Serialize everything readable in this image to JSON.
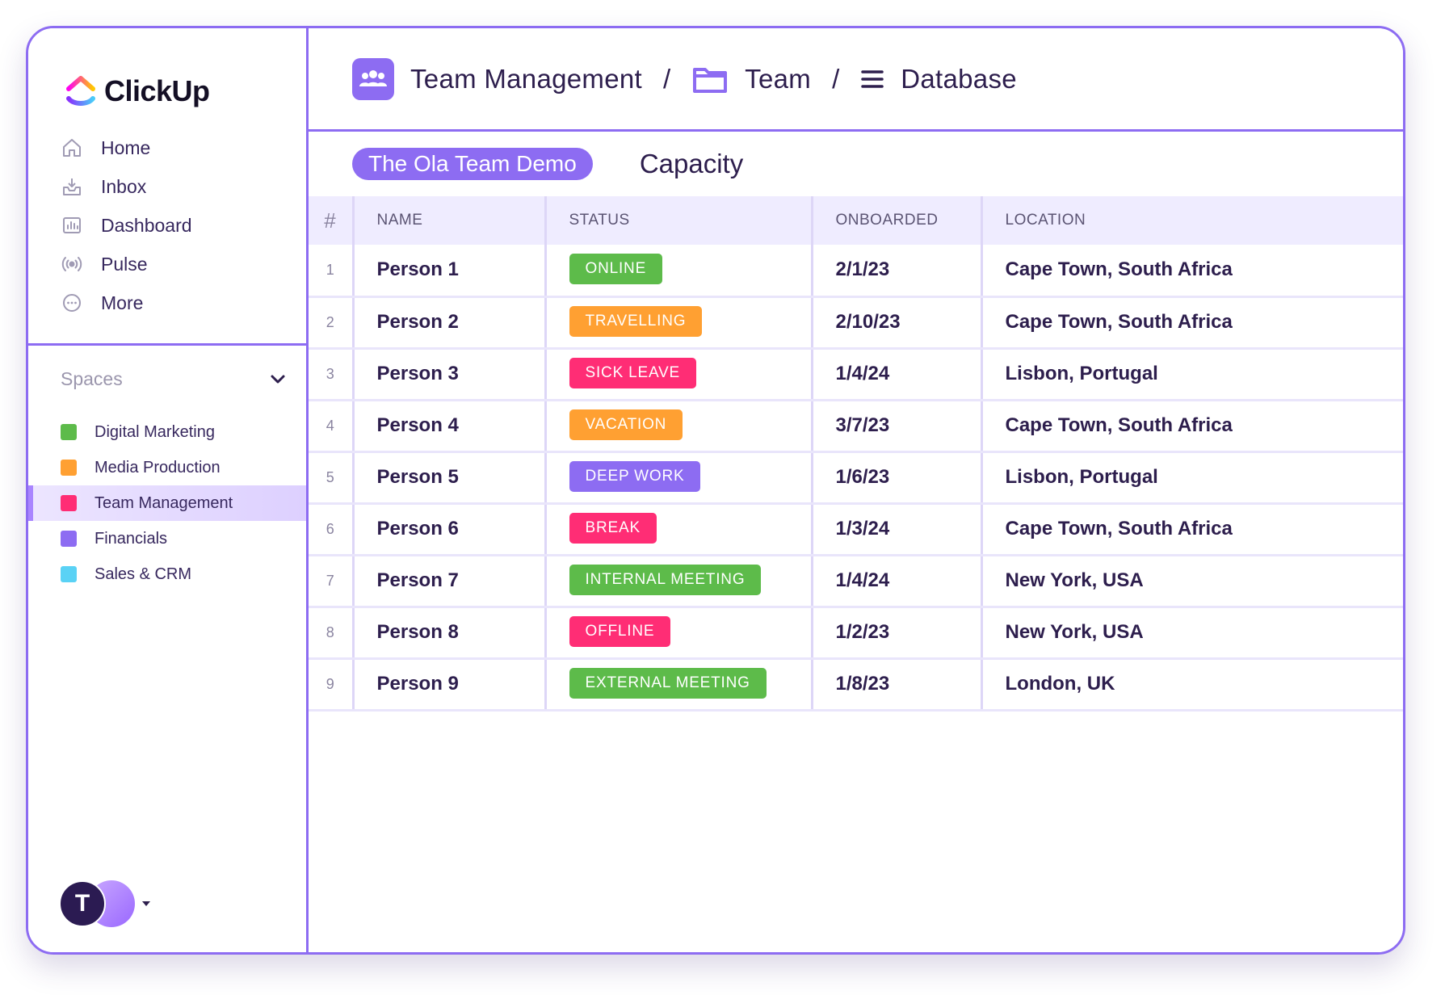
{
  "app": {
    "logo_text": "ClickUp"
  },
  "sidebar": {
    "nav": [
      {
        "label": "Home",
        "icon": "home-icon"
      },
      {
        "label": "Inbox",
        "icon": "inbox-icon"
      },
      {
        "label": "Dashboard",
        "icon": "dashboard-icon"
      },
      {
        "label": "Pulse",
        "icon": "pulse-icon"
      },
      {
        "label": "More",
        "icon": "more-icon"
      }
    ],
    "spaces_label": "Spaces",
    "spaces": [
      {
        "label": "Digital Marketing",
        "color": "#5dbb4a",
        "active": false
      },
      {
        "label": "Media Production",
        "color": "#ffa032",
        "active": false
      },
      {
        "label": "Team Management",
        "color": "#ff2d75",
        "active": true
      },
      {
        "label": "Financials",
        "color": "#8d6cf2",
        "active": false
      },
      {
        "label": "Sales & CRM",
        "color": "#5ad2f5",
        "active": false
      }
    ],
    "avatar_initial": "T"
  },
  "header": {
    "breadcrumb": [
      "Team Management",
      "Team",
      "Database"
    ],
    "separator": "/"
  },
  "view": {
    "workspace_pill": "The Ola Team Demo",
    "title": "Capacity"
  },
  "table": {
    "columns": [
      "#",
      "NAME",
      "STATUS",
      "ONBOARDED",
      "LOCATION"
    ],
    "rows": [
      {
        "idx": "1",
        "name": "Person 1",
        "status": "ONLINE",
        "status_color": "#5dbb4a",
        "onboarded": "2/1/23",
        "location": "Cape Town, South Africa"
      },
      {
        "idx": "2",
        "name": "Person 2",
        "status": "TRAVELLING",
        "status_color": "#ffa032",
        "onboarded": "2/10/23",
        "location": "Cape Town, South Africa"
      },
      {
        "idx": "3",
        "name": "Person 3",
        "status": "SICK LEAVE",
        "status_color": "#ff2d75",
        "onboarded": "1/4/24",
        "location": "Lisbon, Portugal"
      },
      {
        "idx": "4",
        "name": "Person 4",
        "status": "VACATION",
        "status_color": "#ffa032",
        "onboarded": "3/7/23",
        "location": "Cape Town, South Africa"
      },
      {
        "idx": "5",
        "name": "Person 5",
        "status": "DEEP WORK",
        "status_color": "#8d6cf2",
        "onboarded": "1/6/23",
        "location": "Lisbon, Portugal"
      },
      {
        "idx": "6",
        "name": "Person 6",
        "status": "BREAK",
        "status_color": "#ff2d75",
        "onboarded": "1/3/24",
        "location": "Cape Town, South Africa"
      },
      {
        "idx": "7",
        "name": "Person 7",
        "status": "INTERNAL MEETING",
        "status_color": "#5dbb4a",
        "onboarded": "1/4/24",
        "location": "New York, USA"
      },
      {
        "idx": "8",
        "name": "Person 8",
        "status": "OFFLINE",
        "status_color": "#ff2d75",
        "onboarded": "1/2/23",
        "location": "New York, USA"
      },
      {
        "idx": "9",
        "name": "Person 9",
        "status": "EXTERNAL MEETING",
        "status_color": "#5dbb4a",
        "onboarded": "1/8/23",
        "location": "London, UK"
      }
    ]
  }
}
